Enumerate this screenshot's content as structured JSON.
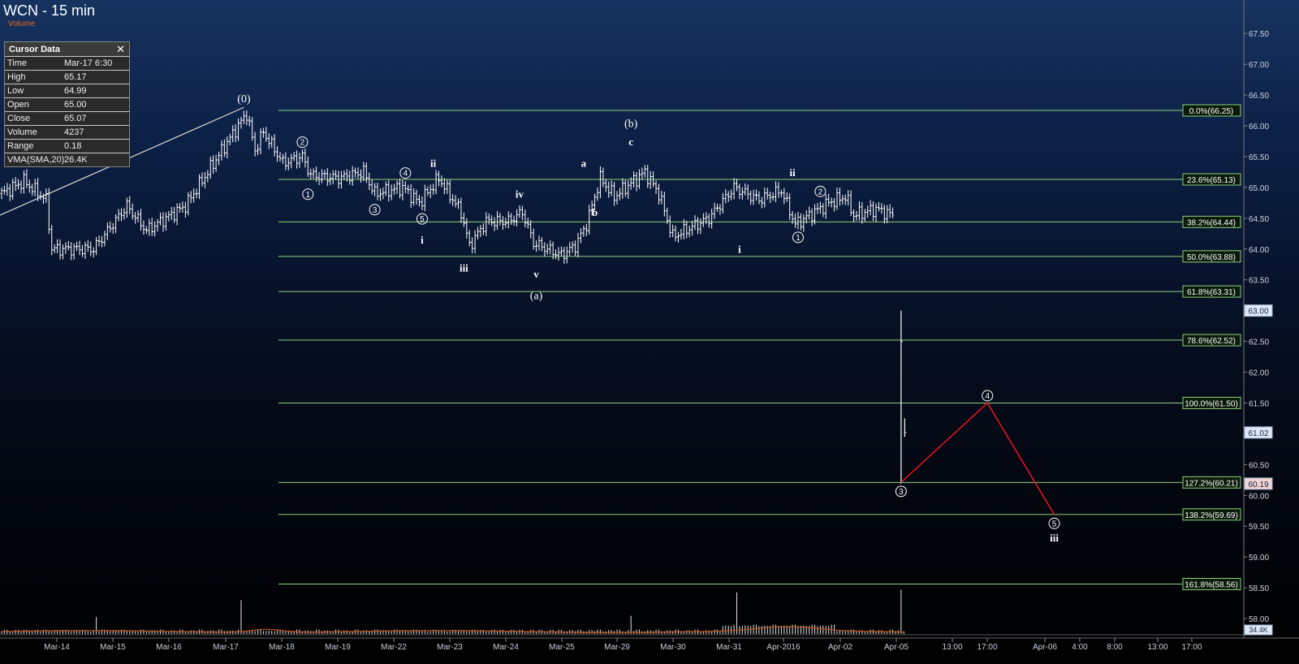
{
  "window": {
    "title": "WCN - 15 min",
    "subtitle": "Volume"
  },
  "cursor_data": {
    "header": "Cursor Data",
    "close_glyph": "✕",
    "rows": [
      {
        "label": "Time",
        "value": "Mar-17 6:30"
      },
      {
        "label": "High",
        "value": "65.17"
      },
      {
        "label": "Low",
        "value": "64.99"
      },
      {
        "label": "Open",
        "value": "65.00"
      },
      {
        "label": "Close",
        "value": "65.07"
      },
      {
        "label": "Volume",
        "value": "4237"
      },
      {
        "label": "Range",
        "value": "0.18"
      },
      {
        "label": "VMA(SMA,20)",
        "value": "26.4K"
      }
    ]
  },
  "colors": {
    "fib_line": "#8fd17a",
    "projection": "#e0161a",
    "bars": "#ffffff",
    "vma": "#c0501c",
    "label_bg": "#0a1a0a"
  },
  "chart_data": {
    "type": "bar",
    "title": "WCN - 15 min",
    "ylim": [
      57.75,
      68.0
    ],
    "y_ticks": [
      "67.50",
      "67.00",
      "66.50",
      "66.00",
      "65.50",
      "65.00",
      "64.50",
      "64.00",
      "63.50",
      "63.00",
      "62.50",
      "62.00",
      "61.50",
      "61.00",
      "60.50",
      "60.00",
      "59.50",
      "59.00",
      "58.50",
      "58.00"
    ],
    "x_ticks": [
      "Mar-14",
      "Mar-15",
      "Mar-16",
      "Mar-17",
      "Mar-18",
      "Mar-19",
      "Mar-22",
      "Mar-23",
      "Mar-24",
      "Mar-25",
      "Mar-29",
      "Mar-30",
      "Mar-31",
      "Apr-2016",
      "Apr-02",
      "Apr-05",
      "13:00",
      "17:00",
      "Apr-06",
      "4:00",
      "8:00",
      "13:00",
      "17:00"
    ],
    "fib_levels": [
      {
        "pct": "0.0%",
        "price": 66.25,
        "label": "0.0%(66.25)"
      },
      {
        "pct": "23.6%",
        "price": 65.13,
        "label": "23.6%(65.13)"
      },
      {
        "pct": "38.2%",
        "price": 64.44,
        "label": "38.2%(64.44)"
      },
      {
        "pct": "50.0%",
        "price": 63.88,
        "label": "50.0%(63.88)"
      },
      {
        "pct": "61.8%",
        "price": 63.31,
        "label": "61.8%(63.31)"
      },
      {
        "pct": "78.6%",
        "price": 62.52,
        "label": "78.6%(62.52)"
      },
      {
        "pct": "100.0%",
        "price": 61.5,
        "label": "100.0%(61.50)"
      },
      {
        "pct": "127.2%",
        "price": 60.21,
        "label": "127.2%(60.21)"
      },
      {
        "pct": "138.2%",
        "price": 59.69,
        "label": "138.2%(59.69)"
      },
      {
        "pct": "161.8%",
        "price": 58.56,
        "label": "161.8%(58.56)"
      }
    ],
    "price_tags": [
      {
        "price": 63.0,
        "label": "63.00"
      },
      {
        "price": 61.02,
        "label": "61.02"
      },
      {
        "price": 60.19,
        "label": "60.19"
      }
    ],
    "volume_tag": "34.4K",
    "anchors": [
      {
        "t": 0,
        "p": 64.9
      },
      {
        "t": 8,
        "p": 65.1
      },
      {
        "t": 16,
        "p": 64.8
      },
      {
        "t": 18,
        "p": 64.0
      },
      {
        "t": 33,
        "p": 64.0
      },
      {
        "t": 45,
        "p": 64.7
      },
      {
        "t": 52,
        "p": 64.3
      },
      {
        "t": 66,
        "p": 64.7
      },
      {
        "t": 82,
        "p": 65.8
      },
      {
        "t": 88,
        "p": 66.2
      },
      {
        "t": 91,
        "p": 65.6
      },
      {
        "t": 94,
        "p": 65.9
      },
      {
        "t": 101,
        "p": 65.4
      },
      {
        "t": 108,
        "p": 65.5
      },
      {
        "t": 111,
        "p": 65.2
      },
      {
        "t": 121,
        "p": 65.15
      },
      {
        "t": 130,
        "p": 65.25
      },
      {
        "t": 134,
        "p": 64.9
      },
      {
        "t": 144,
        "p": 65.0
      },
      {
        "t": 150,
        "p": 64.75
      },
      {
        "t": 157,
        "p": 65.15
      },
      {
        "t": 165,
        "p": 64.6
      },
      {
        "t": 168,
        "p": 64.05
      },
      {
        "t": 174,
        "p": 64.45
      },
      {
        "t": 182,
        "p": 64.45
      },
      {
        "t": 187,
        "p": 64.6
      },
      {
        "t": 191,
        "p": 64.1
      },
      {
        "t": 201,
        "p": 63.9
      },
      {
        "t": 206,
        "p": 64.05
      },
      {
        "t": 210,
        "p": 64.4
      },
      {
        "t": 215,
        "p": 65.15
      },
      {
        "t": 220,
        "p": 64.85
      },
      {
        "t": 231,
        "p": 65.25
      },
      {
        "t": 236,
        "p": 64.9
      },
      {
        "t": 241,
        "p": 64.2
      },
      {
        "t": 254,
        "p": 64.5
      },
      {
        "t": 263,
        "p": 65.0
      },
      {
        "t": 272,
        "p": 64.8
      },
      {
        "t": 280,
        "p": 64.95
      },
      {
        "t": 285,
        "p": 64.4
      },
      {
        "t": 297,
        "p": 64.75
      },
      {
        "t": 303,
        "p": 64.85
      },
      {
        "t": 306,
        "p": 64.55
      },
      {
        "t": 314,
        "p": 64.65
      },
      {
        "t": 320,
        "p": 64.55
      }
    ],
    "last_bars": [
      {
        "high": 63.0,
        "low": 60.19,
        "close": 62.5
      },
      {
        "high": 61.25,
        "low": 60.95,
        "close": 61.02
      }
    ],
    "wave_labels": [
      {
        "text": "(0)",
        "t": 87,
        "p": 66.25,
        "pos": "above",
        "style": "paren"
      },
      {
        "text": "1",
        "t": 110,
        "p": 65.1,
        "pos": "below",
        "style": "circle"
      },
      {
        "text": "2",
        "t": 108,
        "p": 65.55,
        "pos": "above",
        "style": "circle"
      },
      {
        "text": "3",
        "t": 134,
        "p": 64.85,
        "pos": "below",
        "style": "circle"
      },
      {
        "text": "4",
        "t": 145,
        "p": 65.05,
        "pos": "above",
        "style": "circle"
      },
      {
        "text": "5",
        "t": 151,
        "p": 64.7,
        "pos": "below",
        "style": "circle"
      },
      {
        "text": "i",
        "t": 151,
        "p": 64.35,
        "pos": "below",
        "style": "roman"
      },
      {
        "text": "ii",
        "t": 155,
        "p": 65.2,
        "pos": "above",
        "style": "roman"
      },
      {
        "text": "iii",
        "t": 166,
        "p": 63.9,
        "pos": "below",
        "style": "roman"
      },
      {
        "text": "iv",
        "t": 186,
        "p": 64.7,
        "pos": "above",
        "style": "roman"
      },
      {
        "text": "v",
        "t": 192,
        "p": 63.8,
        "pos": "below",
        "style": "roman"
      },
      {
        "text": "(a)",
        "t": 192,
        "p": 63.45,
        "pos": "below",
        "style": "paren"
      },
      {
        "text": "a",
        "t": 209,
        "p": 65.2,
        "pos": "above",
        "style": "roman"
      },
      {
        "text": "b",
        "t": 213,
        "p": 64.8,
        "pos": "below",
        "style": "roman"
      },
      {
        "text": "c",
        "t": 226,
        "p": 65.55,
        "pos": "above",
        "style": "roman"
      },
      {
        "text": "(b)",
        "t": 226,
        "p": 65.85,
        "pos": "above",
        "style": "paren"
      },
      {
        "text": "i",
        "t": 265,
        "p": 64.2,
        "pos": "below",
        "style": "roman"
      },
      {
        "text": "ii",
        "t": 284,
        "p": 65.05,
        "pos": "above",
        "style": "roman"
      },
      {
        "text": "1",
        "t": 286,
        "p": 64.4,
        "pos": "below",
        "style": "circle"
      },
      {
        "text": "2",
        "t": 294,
        "p": 64.75,
        "pos": "above",
        "style": "circle"
      }
    ],
    "projection": [
      {
        "t": 323,
        "p": 60.21,
        "label": "3",
        "pos": "below"
      },
      {
        "t": 354,
        "p": 61.5,
        "label": "4",
        "pos": "above"
      },
      {
        "t": 378,
        "p": 59.69,
        "label": "5",
        "pos": "below",
        "extra": "iii"
      }
    ],
    "volume": {
      "base_max": "34.4K",
      "spikes": [
        {
          "t": 86,
          "v": 2.6
        },
        {
          "t": 264,
          "v": 3.2
        },
        {
          "t": 323,
          "v": 3.4
        },
        {
          "t": 226,
          "v": 1.4
        },
        {
          "t": 34,
          "v": 1.3
        }
      ]
    }
  }
}
